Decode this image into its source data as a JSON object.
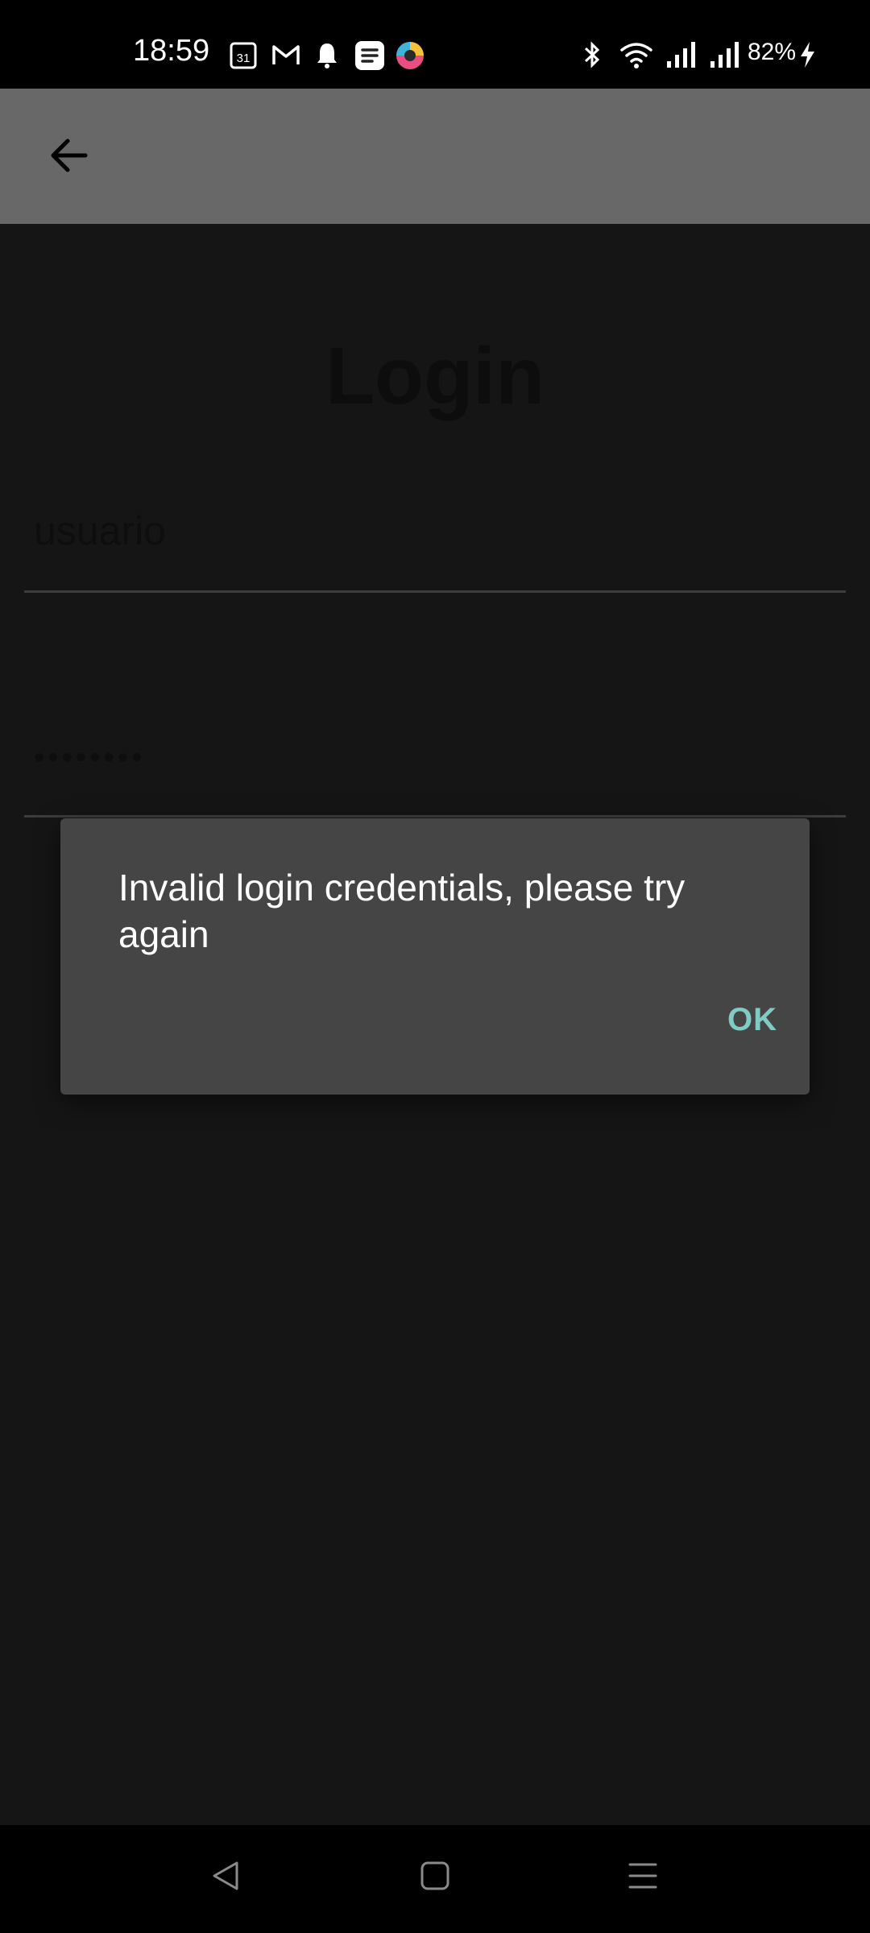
{
  "status_bar": {
    "time": "18:59",
    "battery": "82%",
    "icons": [
      "calendar-icon",
      "gmail-icon",
      "notification-bell-icon",
      "app-notification-icon",
      "browser-icon",
      "bluetooth-icon",
      "wifi-icon",
      "signal-icon",
      "signal-icon",
      "charging-icon"
    ]
  },
  "app_bar": {
    "back_icon": "arrow-back-icon"
  },
  "login": {
    "title": "Login",
    "username_value": "usuario",
    "password_value": "••••••••"
  },
  "dialog": {
    "message": "Invalid login credentials, please try again",
    "ok_label": "OK",
    "accent_color": "#80cbc4"
  },
  "nav_bar": {
    "icons": [
      "back-nav-icon",
      "home-nav-icon",
      "recents-nav-icon"
    ]
  }
}
